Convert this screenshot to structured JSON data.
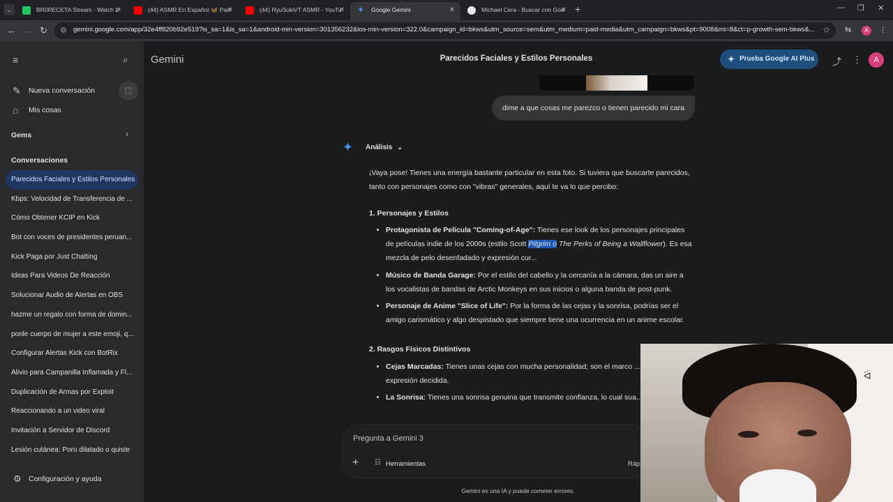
{
  "browser": {
    "tabs": [
      {
        "label": "BR0RECETA Stream - Watch Liv",
        "color": "#22c55e"
      },
      {
        "label": "(44) ASMR En Español 🦋 Para",
        "color": "#ff0000"
      },
      {
        "label": "(44) RyuSukiVT ASMR - YouTub",
        "color": "#ff0000"
      },
      {
        "label": "Google Gemini",
        "color": "#4d8ff0"
      },
      {
        "label": "Michael Cera - Buscar con Goo",
        "color": "#e8eaed"
      }
    ],
    "url": "gemini.google.com/app/32e4ff820b92e519?is_sa=1&is_sa=1&android-min-version=301356232&ios-min-version=322.0&campaign_id=bkws&utm_source=sem&utm_medium=paid-media&utm_campaign=bkws&pt=9008&mt=8&ct=p-growth-sem-bkws&...",
    "profile_initial": "A"
  },
  "sidebar": {
    "new_chat": "Nueva conversación",
    "my_stuff": "Mis cosas",
    "gems": "Gems",
    "conversations_header": "Conversaciones",
    "conversations": [
      "Parecidos Faciales y Estilos Personales",
      "Kbps: Velocidad de Transferencia de ...",
      "Cómo Obtener KCIP en Kick",
      "Bot con voces de presidentes peruan...",
      "Kick Paga por Just Chatting",
      "Ideas Para Videos De Reacción",
      "Solucionar Audio de Alertas en OBS",
      "hazme un regalo con forma de domin...",
      "ponle cuerpo de mujer a este emoji, q...",
      "Configurar Alertas Kick con BotRix",
      "Alivio para Campanilla Inflamada y Fl...",
      "Duplicación de Armas por Exploit",
      "Reaccionando a un video viral",
      "Invitación a Servidor de Discord",
      "Lesión cutánea: Poro dilatado o quiste"
    ],
    "settings": "Configuración y ayuda"
  },
  "header": {
    "brand": "Gemini",
    "title": "Parecidos Faciales y Estilos Personales",
    "upgrade": "Prueba Google AI Plus",
    "avatar": "A"
  },
  "chat": {
    "user_message": "dime a que cosas me parezco o tienen parecido mi cara",
    "model_label": "Análisis",
    "intro": "¡Vaya pose! Tienes una energía bastante particular en esta foto. Si tuviera que buscarte parecidos, tanto con personajes como con \"vibras\" generales, aquí te va lo que percibo:",
    "section1": "1. Personajes y Estilos",
    "s1_items": [
      {
        "title": "Protagonista de Película \"Coming-of-Age\":",
        "text_a": " Tienes ese look de los personajes principales de películas indie de los 2000s (estilo Scott ",
        "highlight": "Pilgrim o",
        "italic": " The Perks of Being a Wallflower",
        "text_b": "). Es esa mezcla de pelo desenfadado y expresión cur..."
      },
      {
        "title": "Músico de Banda Garage:",
        "text": " Por el estilo del cabello y la cercanía a la cámara, das un aire a los vocalistas de bandas de Arctic Monkeys en sus inicios o alguna banda de post-punk."
      },
      {
        "title": "Personaje de Anime \"Slice of Life\":",
        "text": " Por la forma de las cejas y la sonrisa, podrías ser el amigo carismático y algo despistado que siempre tiene una ocurrencia en un anime escolar."
      }
    ],
    "section2": "2. Rasgos Físicos Distintivos",
    "s2_items": [
      {
        "title": "Cejas Marcadas:",
        "text": " Tienes unas cejas con mucha personalidad; son el marco ... dan una expresión decidida."
      },
      {
        "title": "La Sonrisa:",
        "text": " Tienes una sonrisa genuina que transmite confianza, lo cual sua... tus rasgos."
      }
    ]
  },
  "composer": {
    "placeholder": "Pregunta a Gemini 3",
    "tools": "Herramientas",
    "mode": "Rápi"
  },
  "disclaimer": "Gemini es una IA y puede cometer errores.",
  "colors": {
    "accent": "#4d8ff0",
    "active_conv": "#1f3760",
    "background": "#1b1c1d"
  }
}
